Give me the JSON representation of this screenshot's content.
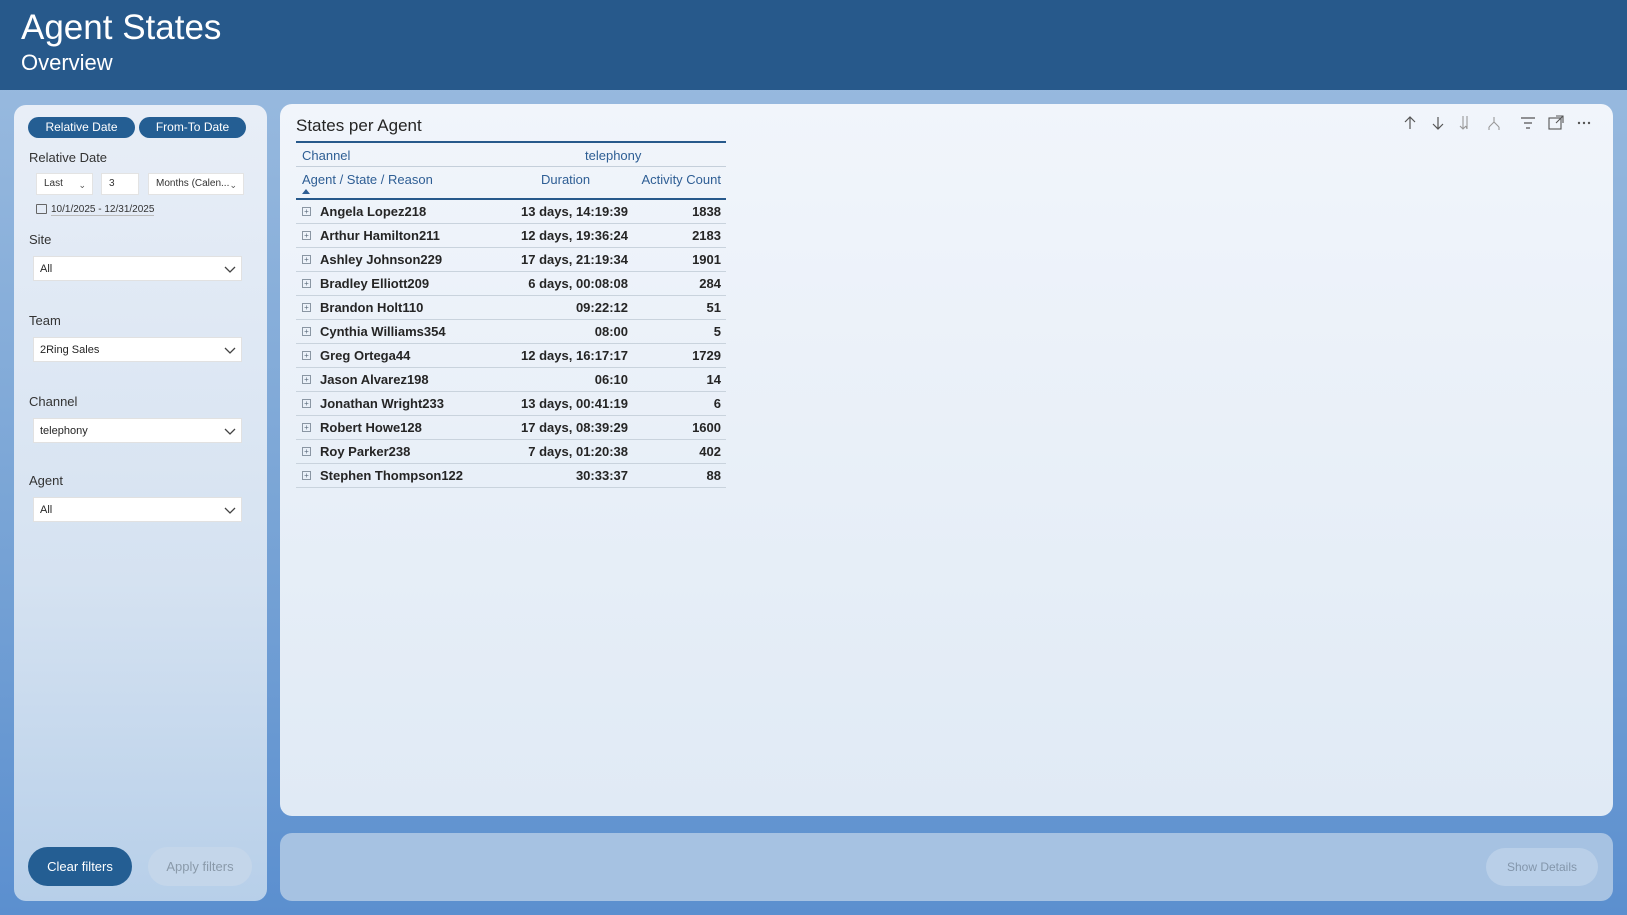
{
  "header": {
    "title": "Agent States",
    "subtitle": "Overview"
  },
  "filters": {
    "date_mode_buttons": [
      "Relative Date",
      "From-To Date"
    ],
    "relative_date": {
      "label": "Relative Date",
      "direction": "Last",
      "amount": "3",
      "unit": "Months (Calen...",
      "range": "10/1/2025 - 12/31/2025"
    },
    "site": {
      "label": "Site",
      "value": "All"
    },
    "team": {
      "label": "Team",
      "value": "2Ring Sales"
    },
    "channel": {
      "label": "Channel",
      "value": "telephony"
    },
    "agent": {
      "label": "Agent",
      "value": "All"
    },
    "clear_label": "Clear filters",
    "apply_label": "Apply filters"
  },
  "visual": {
    "title": "States per Agent",
    "toolbar_icons": [
      "arrow-up-icon",
      "arrow-down-icon",
      "double-arrow-down-icon",
      "fork-icon",
      "filter-icon",
      "focus-mode-icon",
      "more-options-icon"
    ],
    "matrix": {
      "channel_label": "Channel",
      "channel_value": "telephony",
      "columns": [
        "Agent / State / Reason",
        "Duration",
        "Activity Count"
      ],
      "rows": [
        {
          "name": "Angela Lopez218",
          "duration": "13 days, 14:19:39",
          "count": "1838"
        },
        {
          "name": "Arthur Hamilton211",
          "duration": "12 days, 19:36:24",
          "count": "2183"
        },
        {
          "name": "Ashley Johnson229",
          "duration": "17 days, 21:19:34",
          "count": "1901"
        },
        {
          "name": "Bradley Elliott209",
          "duration": "6 days, 00:08:08",
          "count": "284"
        },
        {
          "name": "Brandon Holt110",
          "duration": "09:22:12",
          "count": "51"
        },
        {
          "name": "Cynthia Williams354",
          "duration": "08:00",
          "count": "5"
        },
        {
          "name": "Greg Ortega44",
          "duration": "12 days, 16:17:17",
          "count": "1729"
        },
        {
          "name": "Jason Alvarez198",
          "duration": "06:10",
          "count": "14"
        },
        {
          "name": "Jonathan Wright233",
          "duration": "13 days, 00:41:19",
          "count": "6"
        },
        {
          "name": "Robert Howe128",
          "duration": "17 days, 08:39:29",
          "count": "1600"
        },
        {
          "name": "Roy Parker238",
          "duration": "7 days, 01:20:38",
          "count": "402"
        },
        {
          "name": "Stephen Thompson122",
          "duration": "30:33:37",
          "count": "88"
        }
      ]
    }
  },
  "bottom": {
    "show_details_label": "Show Details"
  },
  "colors": {
    "header": "#27598b",
    "accent": "#245e93",
    "header_text": "#2e5e94"
  }
}
